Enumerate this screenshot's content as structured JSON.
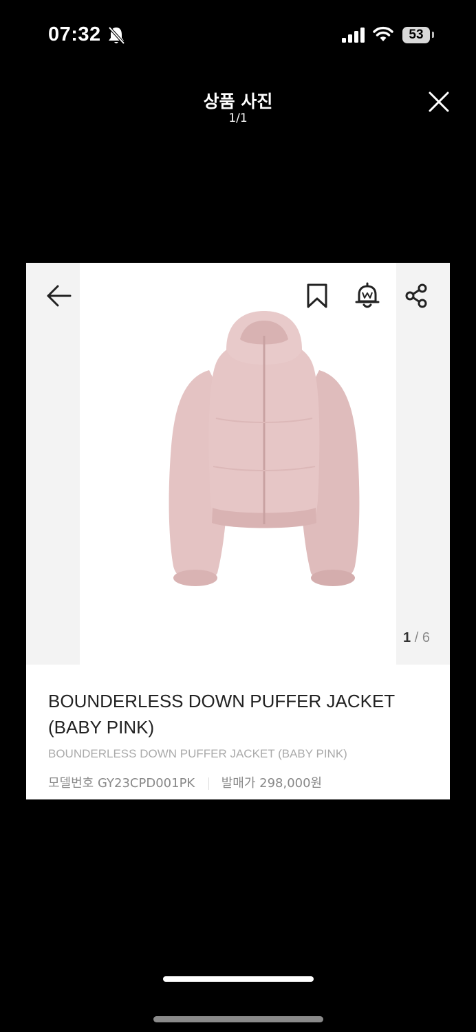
{
  "status_bar": {
    "time": "07:32",
    "battery": "53"
  },
  "header": {
    "title": "상품 사진",
    "counter": "1/1"
  },
  "product": {
    "image_counter_current": "1",
    "image_counter_separator": "/",
    "image_counter_total": "6",
    "name": "BOUNDERLESS DOWN PUFFER JACKET (BABY PINK)",
    "subtitle": "BOUNDERLESS DOWN PUFFER JACKET (BABY PINK)",
    "model_label": "모델번호",
    "model_value": "GY23CPD001PK",
    "price_label": "발매가",
    "price_value": "298,000원",
    "jacket_color": "#e4c3c3"
  },
  "icons": [
    "bell-off-icon",
    "signal-icon",
    "wifi-icon",
    "close-icon",
    "back-arrow-icon",
    "bookmark-icon",
    "alert-bell-icon",
    "share-icon"
  ]
}
